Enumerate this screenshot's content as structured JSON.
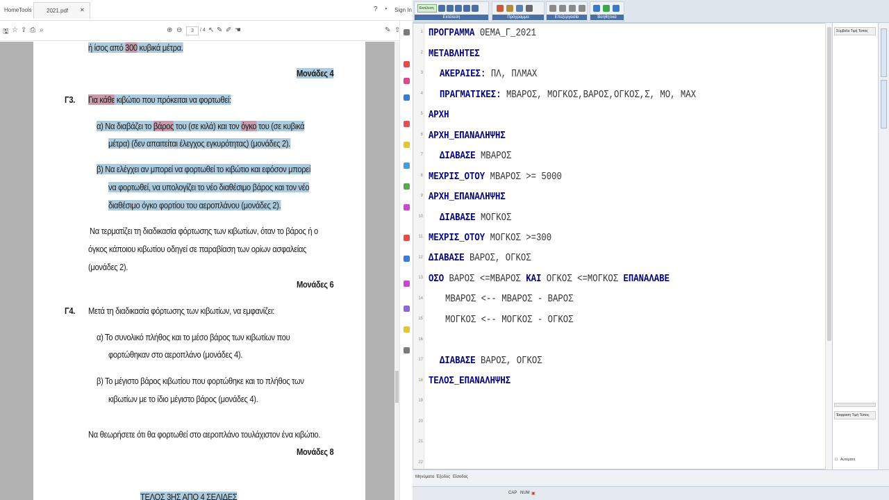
{
  "pdf": {
    "tabs": {
      "home": "Home",
      "tools": "Tools",
      "document": "2021.pdf",
      "sign_in": "Sign In"
    },
    "toolbar": {
      "page_current": "3",
      "page_total": "/ 4"
    },
    "lines": {
      "l1a": "ή ίσος από ",
      "l1b": "300",
      "l1c": " κυβικά μέτρα.",
      "marks4": "Μονάδες 4",
      "g3_label": "Γ3.",
      "g3a": "Για κάθε",
      "g3b": " κιβώτιο που πρόκειται να φορτωθεί:",
      "a1a": "α)  Να διαβάζει το ",
      "a1b": "βάρος",
      "a1c": " του (σε κιλά) και τον ",
      "a1d": "όγκο",
      "a1e": " του (σε κυβικά",
      "a2": "μέτρα) (δεν απαιτείται έλεγχος εγκυρότητας) (μονάδες 2).",
      "b1": "β)  Να ελέγχει αν μπορεί να φορτωθεί το κιβώτιο και εφόσον μπορεί",
      "b2": "να φορτωθεί, να υπολογίζει το νέο διαθέσιμο  βάρος και τον νέο",
      "b3": "διαθέσιμο όγκο φορτίου του αεροπλάνου (μονάδες 2).",
      "t1": "Να τερματίζει τη διαδικασία φόρτωσης των κιβωτίων, όταν το βάρος ή ο",
      "t2": "όγκος κάποιου κιβωτίου οδηγεί σε παραβίαση των ορίων ασφαλείας",
      "t3": "(μονάδες 2).",
      "marks6": "Μονάδες 6",
      "g4_label": "Γ4.",
      "g4": "Μετά τη διαδικασία φόρτωσης των κιβωτίων, να εμφανίζει:",
      "c1": "α)  Το συνολικό πλήθος και το μέσο βάρος των κιβωτίων που",
      "c2": "φορτώθηκαν στο αεροπλάνο (μονάδες 4).",
      "d1": "β)  Το μέγιστο βάρος κιβωτίου που φορτώθηκε και το πλήθος των",
      "d2": "κιβωτίων με το ίδιο μέγιστο βάρος (μονάδες 4).",
      "e1": "Να θεωρήσετε ότι θα φορτωθεί στο αεροπλάνο τουλάχιστον ένα κιβώτιο.",
      "marks8": "Μονάδες 8",
      "footer": "ΤΕΛΟΣ 3ΗΣ ΑΠΟ 4 ΣΕΛΙΔΕΣ"
    }
  },
  "ide": {
    "toolbar": {
      "run": "Εκτέλεση",
      "groups": [
        "Εκτέλεση",
        "Πρόγραμμα",
        "Επεξεργασία",
        "Βοηθητικά"
      ]
    },
    "line_numbers": [
      "1",
      "2",
      "3",
      "4",
      "5",
      "6",
      "7",
      "8",
      "9",
      "10",
      "11",
      "12",
      "13",
      "14",
      "15",
      "16",
      "17",
      "18",
      "19",
      "20",
      "21",
      "22"
    ],
    "code": {
      "c1k": "ΠΡΟΓΡΑΜΜΑ",
      "c1t": " ΘΕΜΑ_Γ_2021",
      "c2k": "ΜΕΤΑΒΛΗΤΕΣ",
      "c3k": "ΑΚΕΡΑΙΕΣ:",
      "c3t": "  ΠΛ, ΠΛΜΑΧ",
      "c4k": "ΠΡΑΓΜΑΤΙΚΕΣ:",
      "c4t": " ΜΒΑΡΟΣ, ΜΟΓΚΟΣ,ΒΑΡΟΣ,ΟΓΚΟΣ,Σ, ΜΟ, ΜΑΧ",
      "c5k": "ΑΡΧΗ",
      "c6k": "ΑΡΧΗ_ΕΠΑΝΑΛΗΨΗΣ",
      "c7k": "ΔΙΑΒΑΣΕ",
      "c7t": " ΜΒΑΡΟΣ",
      "c8k": "ΜΕΧΡΙΣ_ΟΤΟΥ",
      "c8t": " ΜΒΑΡΟΣ >= 5000",
      "c9k": "ΑΡΧΗ_ΕΠΑΝΑΛΗΨΗΣ",
      "c10k": "ΔΙΑΒΑΣΕ",
      "c10t": " ΜΟΓΚΟΣ",
      "c11k": "ΜΕΧΡΙΣ_ΟΤΟΥ",
      "c11t": " ΜΟΓΚΟΣ >=300",
      "c12k": "ΔΙΑΒΑΣΕ",
      "c12t": " ΒΑΡΟΣ, ΟΓΚΟΣ",
      "c13k": "ΟΣΟ",
      "c13t": " ΒΑΡΟΣ <=ΜΒΑΡΟΣ ",
      "c13k2": "ΚΑΙ",
      "c13t2": " ΟΓΚΟΣ <=ΜΟΓΚΟΣ  ",
      "c13k3": "ΕΠΑΝΑΛΑΒΕ",
      "c14t": "ΜΒΑΡΟΣ <-- ΜΒΑΡΟΣ - ΒΑΡΟΣ",
      "c15t": "ΜΟΓΚΟΣ <-- ΜΟΓΚΟΣ - ΟΓΚΟΣ",
      "c17k": "ΔΙΑΒΑΣΕ",
      "c17t": " ΒΑΡΟΣ, ΟΓΚΟΣ",
      "c18k": "ΤΕΛΟΣ_ΕΠΑΝΑΛΗΨΗΣ"
    },
    "vars_panel": {
      "header_top": "Σύμβολο  Τιμή  Τύπος",
      "header_bottom": "Έκφραση  Τιμή  Τύπος",
      "check": "Αυτόματη"
    },
    "bottom_tabs": [
      "Μηνύματα",
      "Έξοδος",
      "Είσοδος"
    ],
    "status": {
      "cap": "CAP",
      "num": "NUM"
    }
  }
}
